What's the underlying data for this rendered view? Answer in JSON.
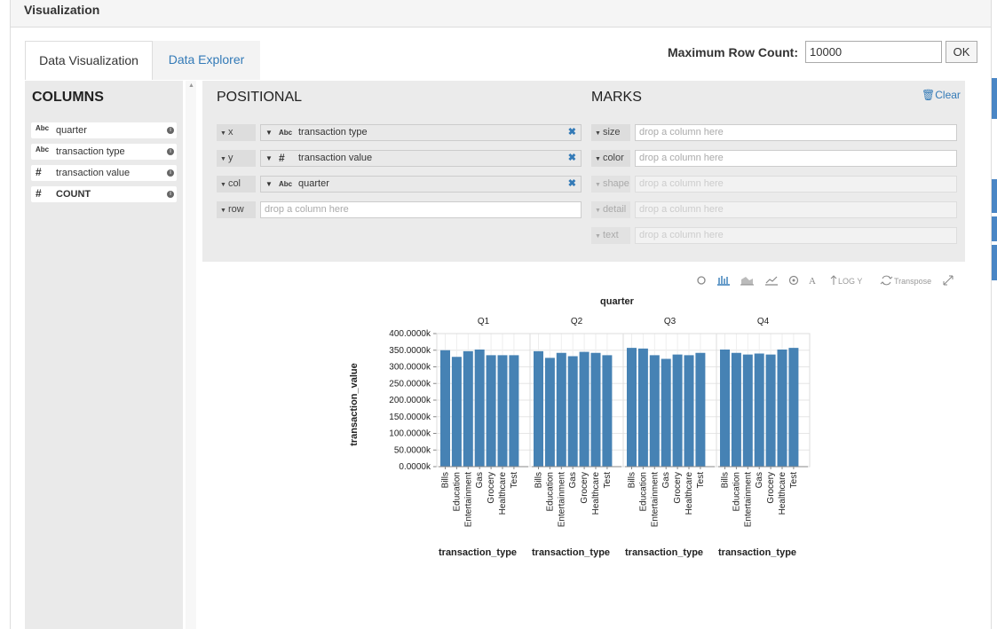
{
  "panel": {
    "title": "Visualization"
  },
  "tabs": [
    {
      "label": "Data Visualization",
      "active": true
    },
    {
      "label": "Data Explorer",
      "active": false
    }
  ],
  "max_row": {
    "label": "Maximum Row Count:",
    "value": "10000",
    "ok_label": "OK"
  },
  "columns": {
    "title": "COLUMNS",
    "items": [
      {
        "type": "Abc",
        "name": "quarter"
      },
      {
        "type": "Abc",
        "name": "transaction type"
      },
      {
        "type": "#",
        "name": "transaction value"
      },
      {
        "type": "#",
        "name": "COUNT"
      }
    ]
  },
  "positional": {
    "title": "POSITIONAL",
    "shelves": [
      {
        "channel": "x",
        "type": "Abc",
        "field": "transaction type"
      },
      {
        "channel": "y",
        "type": "#",
        "field": "transaction value"
      },
      {
        "channel": "col",
        "type": "Abc",
        "field": "quarter"
      },
      {
        "channel": "row",
        "placeholder": "drop a column here"
      }
    ]
  },
  "marks": {
    "title": "MARKS",
    "clear_label": "Clear",
    "shelves": [
      {
        "channel": "size",
        "placeholder": "drop a column here",
        "enabled": true
      },
      {
        "channel": "color",
        "placeholder": "drop a column here",
        "enabled": true
      },
      {
        "channel": "shape",
        "placeholder": "drop a column here",
        "enabled": false
      },
      {
        "channel": "detail",
        "placeholder": "drop a column here",
        "enabled": false
      },
      {
        "channel": "text",
        "placeholder": "drop a column here",
        "enabled": false
      }
    ]
  },
  "toolbar": {
    "icons": [
      "point-icon",
      "bar-icon",
      "area-icon",
      "line-icon",
      "tick-icon",
      "text-mark-icon"
    ],
    "logy_label": "LOG Y",
    "transpose_label": "Transpose"
  },
  "chart_data": {
    "type": "bar",
    "title": "quarter",
    "xlabel": "transaction_type",
    "ylabel": "transaction_value",
    "ylim": [
      0,
      400000
    ],
    "yticks": [
      "0.0000k",
      "50.0000k",
      "100.0000k",
      "150.0000k",
      "200.0000k",
      "250.0000k",
      "300.0000k",
      "350.0000k",
      "400.0000k"
    ],
    "bar_color": "#4682b4",
    "categories": [
      "Bills",
      "Education",
      "Entertainment",
      "Gas",
      "Grocery",
      "Healthcare",
      "Test"
    ],
    "facets": [
      {
        "name": "Q1",
        "values": [
          350000,
          330000,
          347000,
          352000,
          335000,
          335000,
          335000
        ]
      },
      {
        "name": "Q2",
        "values": [
          347000,
          327000,
          342000,
          332000,
          345000,
          342000,
          335000
        ]
      },
      {
        "name": "Q3",
        "values": [
          357000,
          355000,
          335000,
          324000,
          337000,
          335000,
          342000
        ]
      },
      {
        "name": "Q4",
        "values": [
          352000,
          342000,
          337000,
          340000,
          337000,
          352000,
          357000
        ]
      }
    ]
  }
}
